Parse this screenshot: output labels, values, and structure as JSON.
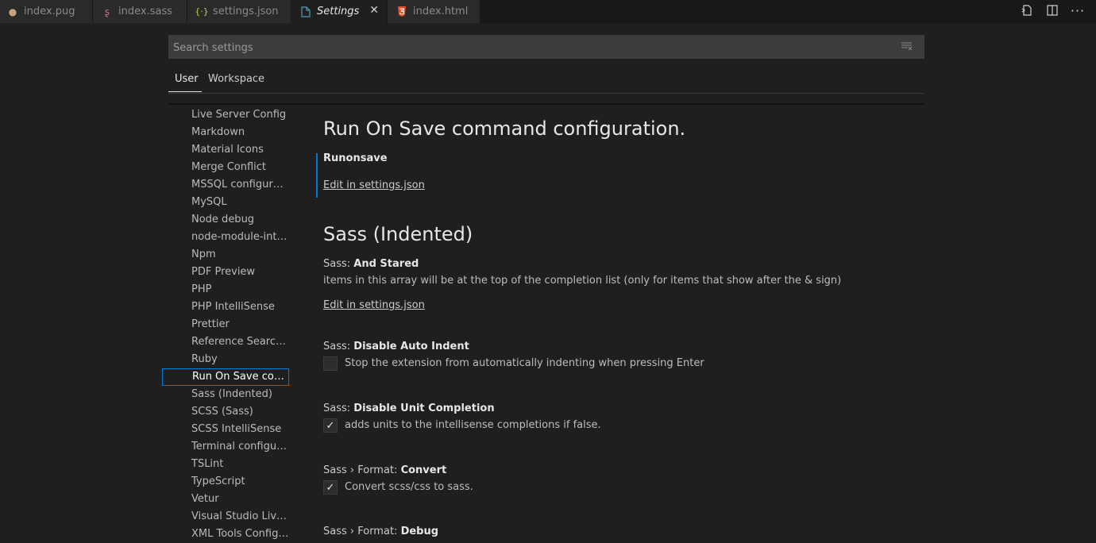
{
  "tabs": [
    {
      "label": "index.pug",
      "icon": "pug-icon",
      "icon_color": "#c9a27e"
    },
    {
      "label": "index.sass",
      "icon": "sass-icon",
      "icon_color": "#cd6799"
    },
    {
      "label": "settings.json",
      "icon": "json-braces-icon",
      "icon_color": "#cbcb41"
    },
    {
      "label": "Settings",
      "icon": "file-icon",
      "icon_color": "#519aba",
      "close": "✕"
    },
    {
      "label": "index.html",
      "icon": "html5-icon",
      "icon_color": "#e44d26"
    }
  ],
  "search": {
    "placeholder": "Search settings"
  },
  "scope": {
    "user": "User",
    "workspace": "Workspace"
  },
  "toc": [
    "Live Server Config",
    "Markdown",
    "Material Icons",
    "Merge Conflict",
    "MSSQL configuration",
    "MySQL",
    "Node debug",
    "node-module-intelli…",
    "Npm",
    "PDF Preview",
    "PHP",
    "PHP IntelliSense",
    "Prettier",
    "Reference Search V…",
    "Ruby",
    "Run On Save com…",
    "Sass (Indented)",
    "SCSS (Sass)",
    "SCSS IntelliSense",
    "Terminal configura…",
    "TSLint",
    "TypeScript",
    "Vetur",
    "Visual Studio Live S…",
    "XML Tools Configu…"
  ],
  "content": {
    "runonsave_heading": "Run On Save command configuration.",
    "runonsave_title": "Runonsave",
    "edit_link": "Edit in settings.json",
    "sass_heading": "Sass (Indented)",
    "and_stared": {
      "prefix": "Sass: ",
      "name": "And Stared",
      "desc": "items in this array will be at the top of the completion list (only for items that show after the & sign)"
    },
    "disable_auto_indent": {
      "prefix": "Sass: ",
      "name": "Disable Auto Indent",
      "desc": "Stop the extension from automatically indenting when pressing Enter"
    },
    "disable_unit_completion": {
      "prefix": "Sass: ",
      "name": "Disable Unit Completion",
      "desc": "adds units to the intellisense completions if false.",
      "checked": "✓"
    },
    "format_convert": {
      "prefix": "Sass › Format: ",
      "name": "Convert",
      "desc": "Convert scss/css to sass.",
      "checked": "✓"
    },
    "format_debug": {
      "prefix": "Sass › Format: ",
      "name": "Debug"
    }
  }
}
